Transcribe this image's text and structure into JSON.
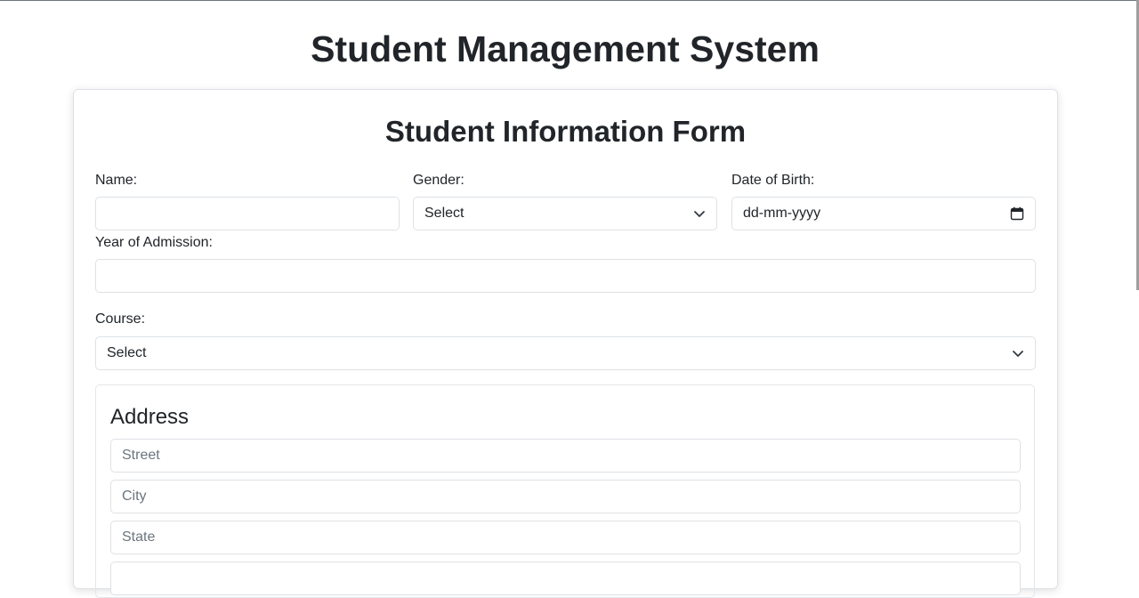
{
  "page": {
    "title": "Student Management System"
  },
  "form": {
    "title": "Student Information Form",
    "name": {
      "label": "Name:",
      "value": ""
    },
    "gender": {
      "label": "Gender:",
      "selected": "Select"
    },
    "dob": {
      "label": "Date of Birth:",
      "placeholder": "dd-mm-yyyy"
    },
    "year_of_admission": {
      "label": "Year of Admission:",
      "value": ""
    },
    "course": {
      "label": "Course:",
      "selected": "Select"
    },
    "address": {
      "title": "Address",
      "street_placeholder": "Street",
      "city_placeholder": "City",
      "state_placeholder": "State"
    }
  },
  "icons": {
    "select_chevron": "chevron-down-icon",
    "date_picker": "calendar-icon"
  }
}
